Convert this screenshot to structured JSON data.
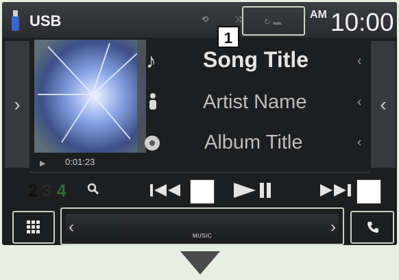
{
  "status_bar": {
    "source": "USB",
    "ampm": "AM",
    "clock": "10:00"
  },
  "callouts": {
    "num1": "1",
    "num2": "2",
    "num3": "3",
    "num4": "4"
  },
  "track": {
    "title": "Song Title",
    "artist": "Artist Name",
    "album": "Album Title",
    "elapsed": "0:01:23"
  },
  "source_bar": {
    "label": "MUSIC"
  },
  "icons": {
    "usb": "usb-icon",
    "music_note": "music-note-icon",
    "artist": "artist-icon",
    "album": "disc-icon",
    "search": "search-icon",
    "prev": "skip-previous-icon",
    "play_pause": "play-pause-icon",
    "next": "skip-next-icon",
    "menu": "grid-menu-icon",
    "phone": "phone-icon"
  },
  "colors": {
    "screen_bg": "#1d1e20",
    "highlight": "#c7d3c1",
    "accent_green": "#2f6a3c"
  }
}
